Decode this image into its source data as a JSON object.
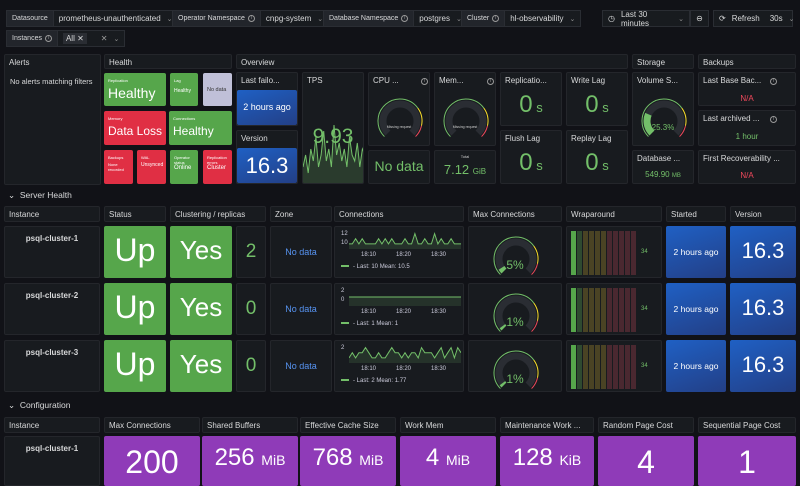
{
  "toolbar": {
    "datasource": {
      "label": "Datasource",
      "value": "prometheus-unauthenticated"
    },
    "operator_ns": {
      "label": "Operator Namespace",
      "value": "cnpg-system"
    },
    "db_ns": {
      "label": "Database Namespace",
      "value": "postgres"
    },
    "cluster": {
      "label": "Cluster",
      "value": "hl-observability"
    },
    "instances": {
      "label": "Instances",
      "value": "All"
    },
    "time_range": "Last 30 minutes",
    "refresh": "Refresh",
    "refresh_interval": "30s"
  },
  "alerts": {
    "title": "Alerts",
    "message": "No alerts matching filters"
  },
  "health": {
    "title": "Health",
    "tiles": [
      {
        "label": "Replication",
        "value": "Healthy",
        "status": "green"
      },
      {
        "label": "Lag",
        "value": "Healthy",
        "status": "green"
      },
      {
        "label": "",
        "value": "No data",
        "status": "nodata"
      },
      {
        "label": "Memory",
        "value": "Data Loss",
        "status": "red"
      },
      {
        "label": "Connections",
        "value": "Healthy",
        "status": "green"
      },
      {
        "label": "Backups",
        "value": "None recorded",
        "status": "red"
      },
      {
        "label": "WAL",
        "value": "Unsynced",
        "status": "red"
      },
      {
        "label": "Operator status",
        "value": "Online",
        "status": "green"
      },
      {
        "label": "Replication errors",
        "value": "Cluster",
        "status": "red"
      }
    ]
  },
  "overview": {
    "title": "Overview",
    "last_failover": {
      "title": "Last failo...",
      "value": "2 hours ago"
    },
    "version": {
      "title": "Version",
      "value": "16.3"
    },
    "tps": {
      "title": "TPS",
      "value": "9.93",
      "series": [
        3,
        5,
        2,
        6,
        4,
        8,
        3,
        5,
        9,
        4,
        6,
        3,
        10,
        5,
        7,
        4,
        6,
        3,
        8,
        5,
        4,
        7,
        3,
        6,
        5
      ]
    },
    "cpu": {
      "title": "CPU ...",
      "gauge_text": "Missing request",
      "value": "No data"
    },
    "memory": {
      "title": "Mem...",
      "gauge_text": "Missing request",
      "total_label": "Total",
      "total_value": "7.12",
      "total_unit": "GiB"
    },
    "replication_lag": {
      "title": "Replicatio...",
      "value": "0",
      "unit": "s"
    },
    "write_lag": {
      "title": "Write Lag",
      "value": "0",
      "unit": "s"
    },
    "flush_lag": {
      "title": "Flush Lag",
      "value": "0",
      "unit": "s"
    },
    "replay_lag": {
      "title": "Replay Lag",
      "value": "0",
      "unit": "s"
    }
  },
  "storage": {
    "title": "Storage",
    "volume": {
      "title": "Volume S...",
      "value": "25.3%",
      "percent": 25.3
    },
    "database": {
      "title": "Database ...",
      "value": "549.90",
      "unit": "MB"
    }
  },
  "backups": {
    "title": "Backups",
    "last_base": {
      "title": "Last Base Bac...",
      "value": "N/A"
    },
    "last_archived": {
      "title": "Last archived ...",
      "value": "1 hour"
    },
    "first_recoverability": {
      "title": "First Recoverability ...",
      "value": "N/A"
    }
  },
  "server_health": {
    "title": "Server Health",
    "columns": [
      "Instance",
      "Status",
      "Clustering / replicas",
      "Zone",
      "Connections",
      "Max Connections",
      "Wraparound",
      "Started",
      "Version"
    ],
    "time_ticks": [
      "18:10",
      "18:20",
      "18:30"
    ],
    "rows": [
      {
        "instance": "psql-cluster-1",
        "status": "Up",
        "clustering": "Yes",
        "replicas": "2",
        "zone": "No data",
        "conn_yticks": [
          "12",
          "10"
        ],
        "conn_legend": "Last: 10  Mean: 10.5",
        "conn_series": [
          10,
          10,
          11,
          10,
          11,
          10,
          10,
          10,
          10,
          11,
          10,
          11,
          10,
          11,
          10,
          10,
          10,
          11,
          10,
          10,
          12,
          10,
          10,
          11,
          10,
          10,
          12,
          10,
          11,
          10,
          10,
          11,
          10,
          10,
          10
        ],
        "conn_range": [
          9,
          12.5
        ],
        "max_conn": "5%",
        "max_conn_pct": 5,
        "wraparound": "34",
        "started": "2 hours ago",
        "version": "16.3"
      },
      {
        "instance": "psql-cluster-2",
        "status": "Up",
        "clustering": "Yes",
        "replicas": "0",
        "zone": "No data",
        "conn_yticks": [
          "2",
          "0"
        ],
        "conn_legend": "Last: 1  Mean: 1",
        "conn_series": [
          1,
          1,
          1,
          1,
          1,
          1,
          1,
          1,
          1,
          1,
          1,
          1,
          1,
          1,
          1,
          1,
          1,
          1,
          1,
          1,
          1,
          1,
          1,
          1,
          1,
          1,
          1,
          1,
          1,
          1,
          1,
          1,
          1,
          1,
          1
        ],
        "conn_range": [
          0,
          2
        ],
        "max_conn": "1%",
        "max_conn_pct": 1,
        "wraparound": "34",
        "started": "2 hours ago",
        "version": "16.3"
      },
      {
        "instance": "psql-cluster-3",
        "status": "Up",
        "clustering": "Yes",
        "replicas": "0",
        "zone": "No data",
        "conn_yticks": [
          "2"
        ],
        "conn_legend": "Last: 2  Mean: 1.77",
        "conn_series": [
          1,
          2,
          1,
          2,
          2,
          3,
          2,
          1,
          1,
          2,
          1,
          1,
          2,
          3,
          2,
          2,
          1,
          2,
          1,
          2,
          2,
          1,
          3,
          2,
          2,
          2,
          1,
          2,
          3,
          1,
          2,
          3,
          1,
          3,
          2
        ],
        "conn_range": [
          0,
          3.5
        ],
        "max_conn": "1%",
        "max_conn_pct": 1,
        "wraparound": "34",
        "started": "2 hours ago",
        "version": "16.3"
      }
    ]
  },
  "configuration": {
    "title": "Configuration",
    "columns": [
      "Instance",
      "Max Connections",
      "Shared Buffers",
      "Effective Cache Size",
      "Work Mem",
      "Maintenance Work ...",
      "Random Page Cost",
      "Sequential Page Cost"
    ],
    "row": {
      "instance": "psql-cluster-1",
      "values": [
        {
          "v": "200",
          "u": ""
        },
        {
          "v": "256",
          "u": "MiB"
        },
        {
          "v": "768",
          "u": "MiB"
        },
        {
          "v": "4",
          "u": "MiB"
        },
        {
          "v": "128",
          "u": "KiB"
        },
        {
          "v": "4",
          "u": ""
        },
        {
          "v": "1",
          "u": ""
        }
      ]
    }
  },
  "colors": {
    "green": "#56a64b",
    "red": "#e02f44",
    "blue": "#1f60c4",
    "purple": "#8f3bb8",
    "text_green": "#73bf69",
    "text_red": "#f2495c",
    "no_data": "#c0c0d8"
  }
}
